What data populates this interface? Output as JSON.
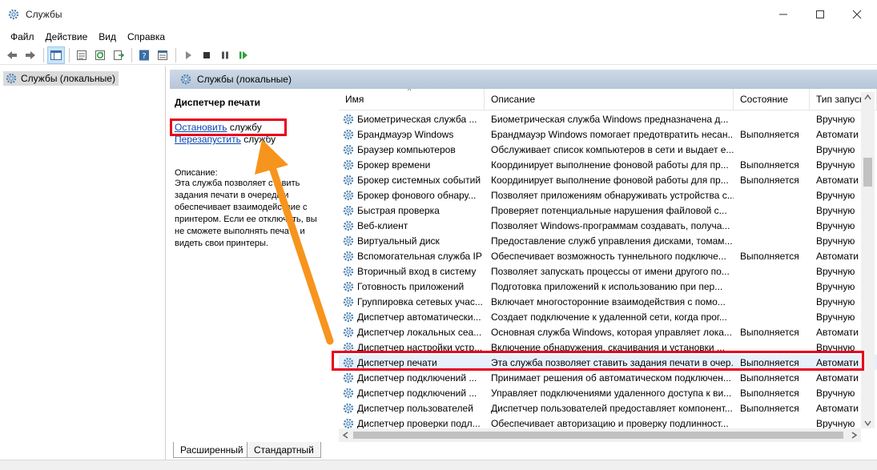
{
  "window": {
    "title": "Службы",
    "buttons": [
      "minimize",
      "maximize",
      "close"
    ]
  },
  "menu": [
    "Файл",
    "Действие",
    "Вид",
    "Справка"
  ],
  "toolbar": {
    "icons": [
      "back-icon",
      "forward-icon",
      "show-tree-icon",
      "console-icon",
      "refresh-icon",
      "export-icon",
      "help-icon",
      "properties-icon",
      "play-icon",
      "stop-icon",
      "pause-icon",
      "resume-icon"
    ]
  },
  "tree": {
    "root": "Службы (локальные)"
  },
  "panel": {
    "header": "Службы (локальные)",
    "selected_service": "Диспетчер печати",
    "link_stop": "Остановить",
    "link_stop_suffix": " службу",
    "link_restart": "Перезапустить",
    "link_restart_suffix": " службу",
    "description_label": "Описание:",
    "description_text": "Эта служба позволяет ставить задания печати в очередь и обеспечивает взаимодействие с принтером. Если ее отключить, вы не сможете выполнять печать и видеть свои принтеры."
  },
  "columns": [
    "Имя",
    "Описание",
    "Состояние",
    "Тип запуска"
  ],
  "rows": [
    {
      "name": "Биометрическая служба ...",
      "desc": "Биометрическая служба Windows предназначена д...",
      "state": "",
      "type": "Вручную"
    },
    {
      "name": "Брандмауэр Windows",
      "desc": "Брандмауэр Windows помогает предотвратить несан...",
      "state": "Выполняется",
      "type": "Автомати"
    },
    {
      "name": "Браузер компьютеров",
      "desc": "Обслуживает список компьютеров в сети и выдает е...",
      "state": "",
      "type": "Вручную"
    },
    {
      "name": "Брокер времени",
      "desc": "Координирует выполнение фоновой работы для пр...",
      "state": "Выполняется",
      "type": "Вручную"
    },
    {
      "name": "Брокер системных событий",
      "desc": "Координирует выполнение фоновой работы для пр...",
      "state": "Выполняется",
      "type": "Автомати"
    },
    {
      "name": "Брокер фонового обнару...",
      "desc": "Позволяет приложениям обнаруживать устройства с...",
      "state": "",
      "type": "Вручную"
    },
    {
      "name": "Быстрая проверка",
      "desc": "Проверяет потенциальные нарушения файловой с...",
      "state": "",
      "type": "Вручную"
    },
    {
      "name": "Веб-клиент",
      "desc": "Позволяет Windows-программам создавать, получа...",
      "state": "",
      "type": "Вручную"
    },
    {
      "name": "Виртуальный диск",
      "desc": "Предоставление служб управления дисками, томам...",
      "state": "",
      "type": "Вручную"
    },
    {
      "name": "Вспомогательная служба IP",
      "desc": "Обеспечивает возможность туннельного подключе...",
      "state": "Выполняется",
      "type": "Автомати"
    },
    {
      "name": "Вторичный вход в систему",
      "desc": "Позволяет запускать процессы от имени другого по...",
      "state": "",
      "type": "Вручную"
    },
    {
      "name": "Готовность приложений",
      "desc": "Подготовка приложений к использованию при пер...",
      "state": "",
      "type": "Вручную"
    },
    {
      "name": "Группировка сетевых учас...",
      "desc": "Включает многосторонние взаимодействия с помо...",
      "state": "",
      "type": "Вручную"
    },
    {
      "name": "Диспетчер автоматически...",
      "desc": "Создает подключение к удаленной сети, когда прог...",
      "state": "",
      "type": "Вручную"
    },
    {
      "name": "Диспетчер локальных сеа...",
      "desc": "Основная служба Windows, которая управляет лока...",
      "state": "Выполняется",
      "type": "Автомати"
    },
    {
      "name": "Диспетчер настройки устр...",
      "desc": "Включение обнаружения, скачивания и установки ...",
      "state": "",
      "type": "Вручную"
    },
    {
      "name": "Диспетчер печати",
      "desc": "Эта служба позволяет ставить задания печати в очер...",
      "state": "Выполняется",
      "type": "Автомати",
      "selected": true
    },
    {
      "name": "Диспетчер подключений ...",
      "desc": "Принимает решения об автоматическом подключен...",
      "state": "Выполняется",
      "type": "Автомати"
    },
    {
      "name": "Диспетчер подключений ...",
      "desc": "Управляет подключениями удаленного доступа к ви...",
      "state": "Выполняется",
      "type": "Вручную"
    },
    {
      "name": "Диспетчер пользователей",
      "desc": "Диспетчер пользователей предоставляет компонент...",
      "state": "Выполняется",
      "type": "Автомати"
    },
    {
      "name": "Диспетчер проверки подл...",
      "desc": "Обеспечивает авторизацию и проверку подлинност...",
      "state": "",
      "type": "Вручную"
    }
  ],
  "tabs": [
    "Расширенный",
    "Стандартный"
  ],
  "colors": {
    "highlight": "#e8001c",
    "arrow": "#f7941d",
    "link": "#0645ad",
    "panel_header": "#c3d1e0"
  }
}
